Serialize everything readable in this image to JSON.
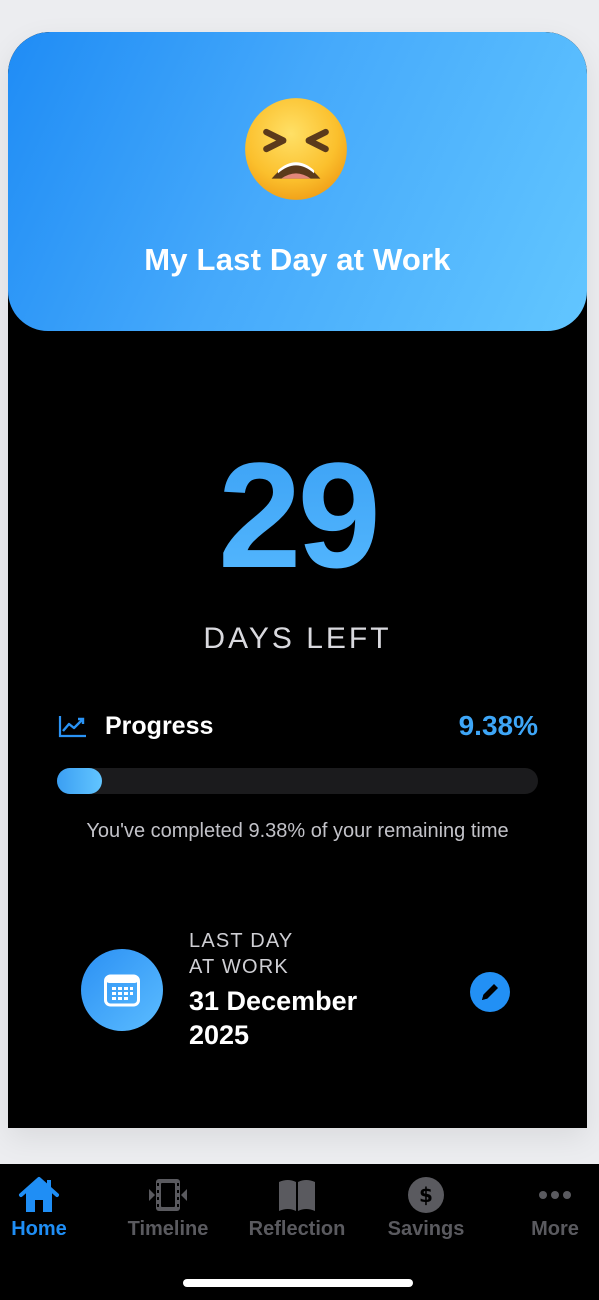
{
  "header": {
    "title": "My Last Day at Work",
    "emoji": "😫",
    "colors": {
      "gradient_start": "#1f8cf5",
      "gradient_end": "#62c6ff"
    }
  },
  "countdown": {
    "days": "29",
    "label": "DAYS LEFT"
  },
  "progress": {
    "label": "Progress",
    "value_text": "9.38%",
    "fraction": 0.0938,
    "caption": "You've completed 9.38% of your remaining time",
    "icon": "trend-chart-icon"
  },
  "last_day": {
    "title_line1": "LAST DAY",
    "title_line2": "AT WORK",
    "date_line1": "31 December",
    "date_line2": "2025",
    "icon": "calendar-icon",
    "edit_icon": "pencil-icon"
  },
  "tabbar": {
    "tabs": [
      {
        "label": "Home",
        "icon": "house-icon",
        "active": true
      },
      {
        "label": "Timeline",
        "icon": "film-strip-icon",
        "active": false
      },
      {
        "label": "Reflection",
        "icon": "book-icon",
        "active": false
      },
      {
        "label": "Savings",
        "icon": "dollar-circle-icon",
        "active": false
      },
      {
        "label": "More",
        "icon": "ellipsis-icon",
        "active": false
      }
    ],
    "accent": "#1f8ef5",
    "inactive": "#5a5a5f"
  }
}
